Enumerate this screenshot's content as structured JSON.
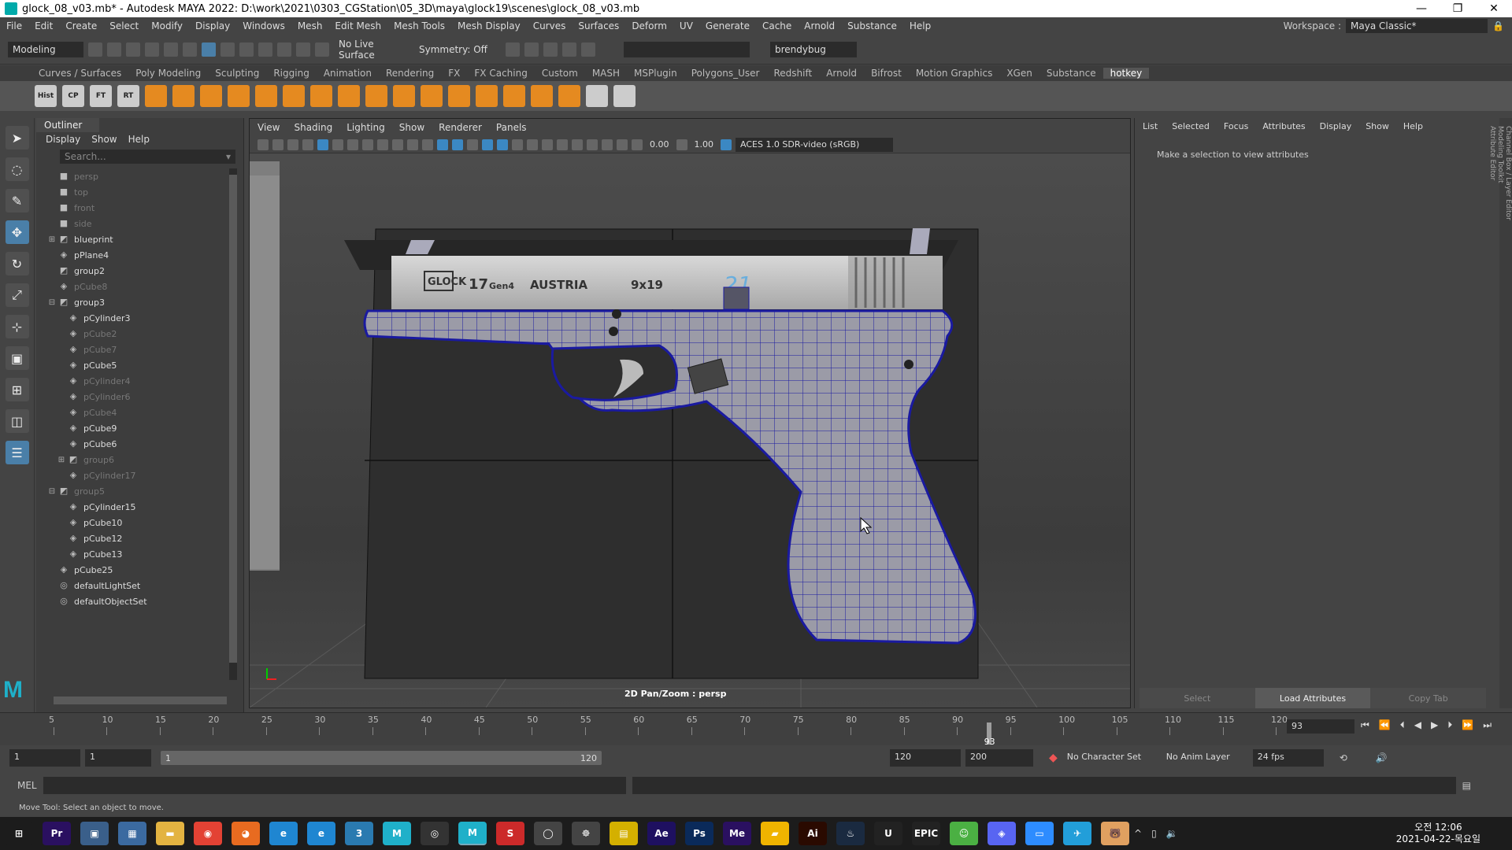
{
  "window": {
    "title": "glock_08_v03.mb* - Autodesk MAYA 2022: D:\\work\\2021\\0303_CGStation\\05_3D\\maya\\glock19\\scenes\\glock_08_v03.mb",
    "controls": [
      "—",
      "❐",
      "✕"
    ]
  },
  "menus": [
    "File",
    "Edit",
    "Create",
    "Select",
    "Modify",
    "Display",
    "Windows",
    "Mesh",
    "Edit Mesh",
    "Mesh Tools",
    "Mesh Display",
    "Curves",
    "Surfaces",
    "Deform",
    "UV",
    "Generate",
    "Cache",
    "Arnold",
    "Substance",
    "Help"
  ],
  "workspace": {
    "label": "Workspace :",
    "value": "Maya Classic*"
  },
  "status_line": {
    "mode": "Modeling",
    "live_surface": "No Live Surface",
    "symmetry": "Symmetry: Off",
    "user": "brendybug"
  },
  "shelf_tabs": [
    "Curves / Surfaces",
    "Poly Modeling",
    "Sculpting",
    "Rigging",
    "Animation",
    "Rendering",
    "FX",
    "FX Caching",
    "Custom",
    "MASH",
    "MSPlugin",
    "Polygons_User",
    "Redshift",
    "Arnold",
    "Bifrost",
    "Motion Graphics",
    "XGen",
    "Substance",
    "hotkey"
  ],
  "shelf_active": "hotkey",
  "shelf_labels": [
    "Hist",
    "CP",
    "FT",
    "RT"
  ],
  "outliner": {
    "tab": "Outliner",
    "menu": [
      "Display",
      "Show",
      "Help"
    ],
    "search_placeholder": "Search...",
    "items": [
      {
        "label": "persp",
        "indent": 0,
        "icon": "camera-icon",
        "dim": true,
        "expander": ""
      },
      {
        "label": "top",
        "indent": 0,
        "icon": "camera-icon",
        "dim": true,
        "expander": ""
      },
      {
        "label": "front",
        "indent": 0,
        "icon": "camera-icon",
        "dim": true,
        "expander": ""
      },
      {
        "label": "side",
        "indent": 0,
        "icon": "camera-icon",
        "dim": true,
        "expander": ""
      },
      {
        "label": "blueprint",
        "indent": 0,
        "icon": "group-icon",
        "dim": false,
        "expander": "+"
      },
      {
        "label": "pPlane4",
        "indent": 0,
        "icon": "mesh-icon",
        "dim": false,
        "expander": ""
      },
      {
        "label": "group2",
        "indent": 0,
        "icon": "group-icon",
        "dim": false,
        "expander": ""
      },
      {
        "label": "pCube8",
        "indent": 0,
        "icon": "mesh-icon",
        "dim": true,
        "expander": ""
      },
      {
        "label": "group3",
        "indent": 0,
        "icon": "group-icon",
        "dim": false,
        "expander": "−"
      },
      {
        "label": "pCylinder3",
        "indent": 1,
        "icon": "mesh-icon",
        "dim": false,
        "expander": ""
      },
      {
        "label": "pCube2",
        "indent": 1,
        "icon": "mesh-icon",
        "dim": true,
        "expander": ""
      },
      {
        "label": "pCube7",
        "indent": 1,
        "icon": "mesh-icon",
        "dim": true,
        "expander": ""
      },
      {
        "label": "pCube5",
        "indent": 1,
        "icon": "mesh-icon",
        "dim": false,
        "expander": ""
      },
      {
        "label": "pCylinder4",
        "indent": 1,
        "icon": "mesh-icon",
        "dim": true,
        "expander": ""
      },
      {
        "label": "pCylinder6",
        "indent": 1,
        "icon": "mesh-icon",
        "dim": true,
        "expander": ""
      },
      {
        "label": "pCube4",
        "indent": 1,
        "icon": "mesh-icon",
        "dim": true,
        "expander": ""
      },
      {
        "label": "pCube9",
        "indent": 1,
        "icon": "mesh-icon",
        "dim": false,
        "expander": ""
      },
      {
        "label": "pCube6",
        "indent": 1,
        "icon": "mesh-icon",
        "dim": false,
        "expander": ""
      },
      {
        "label": "group6",
        "indent": 1,
        "icon": "group-icon",
        "dim": true,
        "expander": "+"
      },
      {
        "label": "pCylinder17",
        "indent": 1,
        "icon": "mesh-icon",
        "dim": true,
        "expander": ""
      },
      {
        "label": "group5",
        "indent": 0,
        "icon": "group-icon",
        "dim": true,
        "expander": "−"
      },
      {
        "label": "pCylinder15",
        "indent": 1,
        "icon": "mesh-icon",
        "dim": false,
        "expander": ""
      },
      {
        "label": "pCube10",
        "indent": 1,
        "icon": "mesh-icon",
        "dim": false,
        "expander": ""
      },
      {
        "label": "pCube12",
        "indent": 1,
        "icon": "mesh-icon",
        "dim": false,
        "expander": ""
      },
      {
        "label": "pCube13",
        "indent": 1,
        "icon": "mesh-icon",
        "dim": false,
        "expander": ""
      },
      {
        "label": "pCube25",
        "indent": 0,
        "icon": "mesh-icon",
        "dim": false,
        "expander": ""
      },
      {
        "label": "defaultLightSet",
        "indent": 0,
        "icon": "set-icon",
        "dim": false,
        "expander": ""
      },
      {
        "label": "defaultObjectSet",
        "indent": 0,
        "icon": "set-icon",
        "dim": false,
        "expander": ""
      }
    ]
  },
  "viewport": {
    "menu": [
      "View",
      "Shading",
      "Lighting",
      "Show",
      "Renderer",
      "Panels"
    ],
    "exposure": "0.00",
    "gamma": "1.00",
    "color_space": "ACES 1.0 SDR-video (sRGB)",
    "label": "2D Pan/Zoom : persp",
    "slide_text": {
      "brand": "GLOCK",
      "model": "17",
      "gen": "Gen4",
      "country": "AUSTRIA",
      "caliber": "9x19",
      "serial": "21"
    }
  },
  "channel_box": {
    "menu": [
      "List",
      "Selected",
      "Focus",
      "Attributes",
      "Display",
      "Show",
      "Help"
    ],
    "message": "Make a selection to view attributes",
    "buttons": [
      "Select",
      "Load Attributes",
      "Copy Tab"
    ],
    "side_tabs": [
      "Channel Box / Layer Editor",
      "Modeling Toolkit",
      "Attribute Editor"
    ]
  },
  "timeline": {
    "ticks": [
      "5",
      "10",
      "15",
      "20",
      "25",
      "30",
      "35",
      "40",
      "45",
      "50",
      "55",
      "60",
      "65",
      "70",
      "75",
      "80",
      "85",
      "90",
      "95",
      "100",
      "105",
      "110",
      "115",
      "120"
    ],
    "current_frame": "93",
    "playhead_label": "93",
    "range_max": 120,
    "playback_icons": [
      "⏮",
      "⏪",
      "⏴",
      "◀",
      "▶",
      "⏵",
      "⏩",
      "⏭"
    ]
  },
  "range": {
    "start": "1",
    "anim_start": "1",
    "slider_start": "1",
    "slider_end": "120",
    "end": "120",
    "anim_end": "200",
    "character_set": "No Character Set",
    "anim_layer": "No Anim Layer",
    "fps": "24 fps"
  },
  "command_line": {
    "label": "MEL"
  },
  "help_line": "Move Tool: Select an object to move.",
  "taskbar": {
    "apps": [
      "⊞",
      "Pr",
      "▣",
      "▦",
      "▬",
      "◉",
      "◕",
      "e",
      "e",
      "3",
      "M",
      "◎",
      "M",
      "S",
      "◯",
      "☸",
      "▤",
      "Ae",
      "Ps",
      "Me",
      "▰",
      "Ai",
      "♨",
      "U",
      "EPIC",
      "☺",
      "◈",
      "▭",
      "✈",
      "🐻"
    ],
    "active_index": 12,
    "clock_time": "오전 12:06",
    "clock_date": "2021-04-22-목요일"
  },
  "colors": {
    "accent": "#1fb0c9",
    "wireframe": "#1a1aa0",
    "active_tool": "#4a7fa8"
  }
}
